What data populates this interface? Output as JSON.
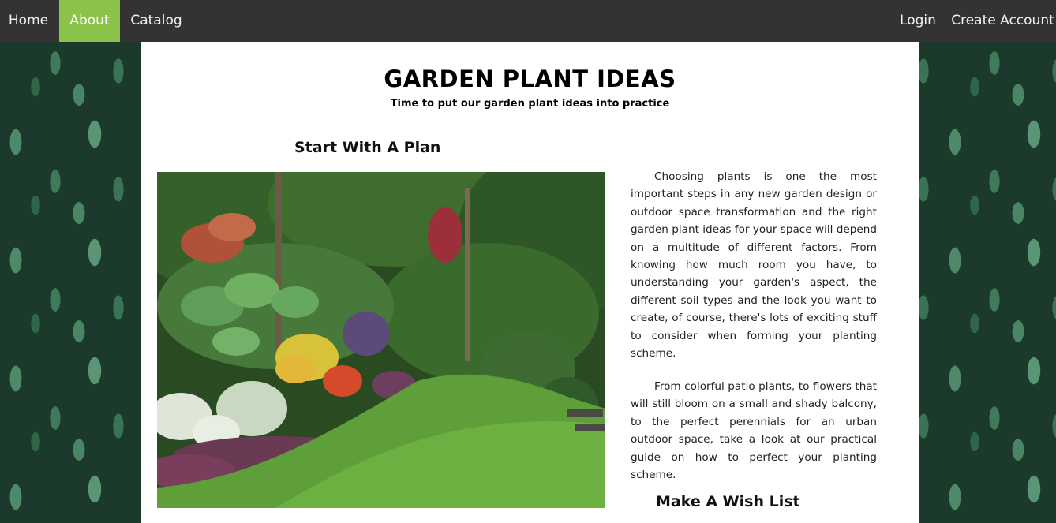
{
  "nav": {
    "home": "Home",
    "about": "About",
    "catalog": "Catalog",
    "login": "Login",
    "create_account": "Create Account",
    "active": "About",
    "active_color": "#8bc34a",
    "bar_color": "#333333"
  },
  "header": {
    "title": "GARDEN PLANT IDEAS",
    "subtitle": "Time to put our garden plant ideas into practice"
  },
  "sections": {
    "plan_heading": "Start With A Plan",
    "wish_heading": "Make A Wish List"
  },
  "body": {
    "paragraph_1": "Choosing plants is one the most important steps in any new garden design or outdoor space transformation and the right garden plant ideas for your space will depend on a multitude of different factors. From knowing how much room you have, to understanding your garden's aspect, the different soil types and the look you want to create, of course, there's lots of exciting stuff to consider when forming your planting scheme.",
    "paragraph_2": "From colorful patio plants, to flowers that will still bloom on a small and shady balcony, to the perfect perennials for an urban outdoor space, take a look at our practical guide on how to perfect your planting scheme."
  },
  "icons": {
    "background": "leaf-pattern-background",
    "image": "tropical-garden-photo"
  }
}
